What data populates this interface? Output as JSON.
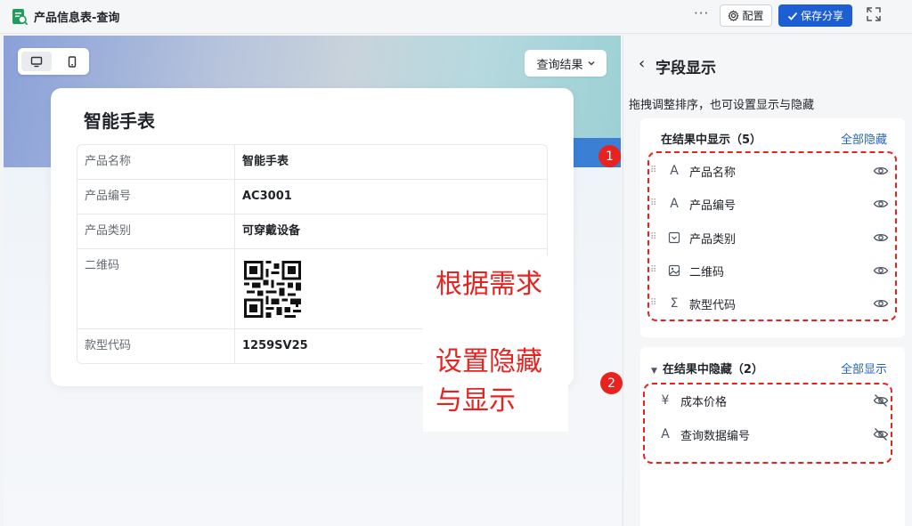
{
  "app": {
    "title": "产品信息表-查询",
    "more_label": "···",
    "config_label": "配置",
    "save_label": "保存分享"
  },
  "preview": {
    "query_result_label": "查询结果",
    "card_title": "智能手表",
    "fields": [
      {
        "key": "产品名称",
        "value": "智能手表"
      },
      {
        "key": "产品编号",
        "value": "AC3001"
      },
      {
        "key": "产品类别",
        "value": "可穿戴设备"
      },
      {
        "key": "二维码",
        "value": ""
      },
      {
        "key": "款型代码",
        "value": "1259SV25"
      }
    ],
    "note_line1": "根据需求",
    "note_line2": "设置隐藏",
    "note_line3": "与显示"
  },
  "panel": {
    "back_label": "‹",
    "title": "字段显示",
    "hint": "拖拽调整排序，也可设置显示与隐藏",
    "shown_group": {
      "title": "在结果中显示（5）",
      "action": "全部隐藏",
      "items": [
        {
          "label": "产品名称",
          "icon": "text-icon"
        },
        {
          "label": "产品编号",
          "icon": "text-icon"
        },
        {
          "label": "产品类别",
          "icon": "select-icon"
        },
        {
          "label": "二维码",
          "icon": "image-icon"
        },
        {
          "label": "款型代码",
          "icon": "formula-icon"
        }
      ]
    },
    "hidden_group": {
      "title": "在结果中隐藏（2）",
      "action": "全部显示",
      "items": [
        {
          "label": "成本价格",
          "icon": "currency-icon"
        },
        {
          "label": "查询数据编号",
          "icon": "text-icon"
        }
      ]
    },
    "badges": [
      "1",
      "2"
    ]
  },
  "colors": {
    "accent": "#1d5fd3",
    "annotation": "#e8231f",
    "link": "#2563c9"
  }
}
